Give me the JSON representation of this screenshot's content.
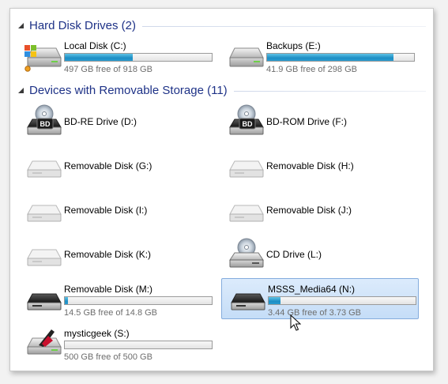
{
  "groups": [
    {
      "title": "Hard Disk Drives (2)"
    },
    {
      "title": "Devices with Removable Storage (11)"
    }
  ],
  "drives": {
    "c": {
      "name": "Local Disk (C:)",
      "free": "497 GB free of 918 GB",
      "used_fraction": 0.46
    },
    "e": {
      "name": "Backups (E:)",
      "free": "41.9 GB free of 298 GB",
      "used_fraction": 0.86
    },
    "d": {
      "name": "BD-RE Drive (D:)"
    },
    "f": {
      "name": "BD-ROM Drive (F:)"
    },
    "g": {
      "name": "Removable Disk (G:)"
    },
    "h": {
      "name": "Removable Disk (H:)"
    },
    "i": {
      "name": "Removable Disk (I:)"
    },
    "j": {
      "name": "Removable Disk (J:)"
    },
    "k": {
      "name": "Removable Disk (K:)"
    },
    "l": {
      "name": "CD Drive (L:)"
    },
    "m": {
      "name": "Removable Disk (M:)",
      "free": "14.5 GB free of 14.8 GB",
      "used_fraction": 0.02
    },
    "n": {
      "name": "MSSS_Media64 (N:)",
      "free": "3.44 GB free of 3.73 GB",
      "used_fraction": 0.08
    },
    "s": {
      "name": "mysticgeek (S:)",
      "free": "500 GB free of 500 GB",
      "used_fraction": 0.0
    }
  },
  "icons": {
    "bd_label": "BD"
  },
  "colors": {
    "header_text": "#1e3287",
    "bar_fill": "#1d8ec4",
    "selection": "#c5ddf7"
  }
}
